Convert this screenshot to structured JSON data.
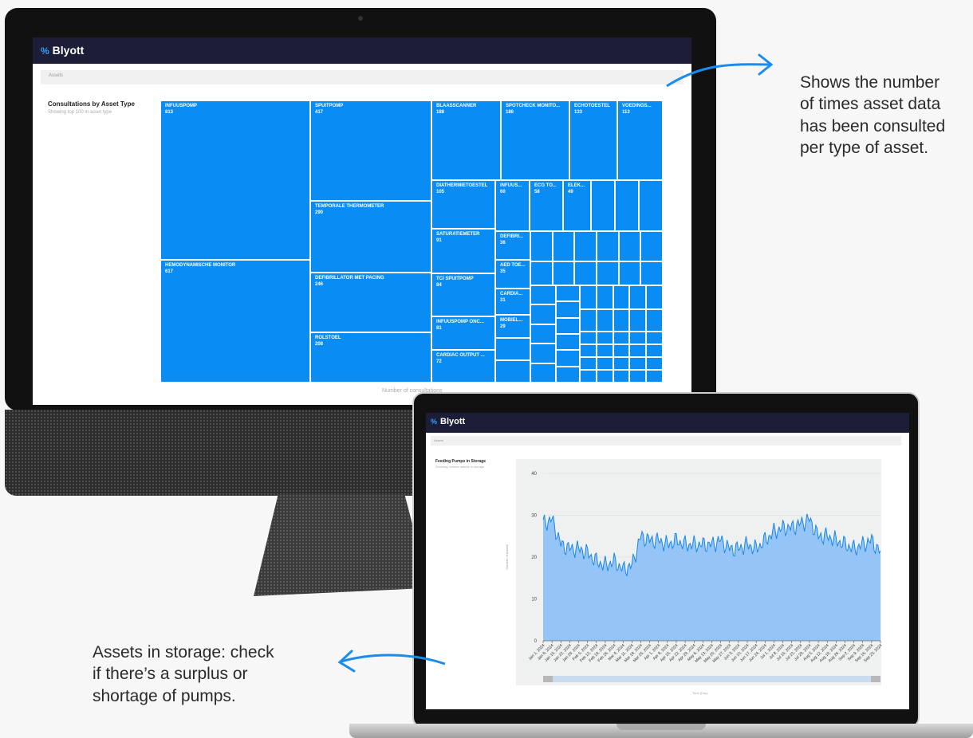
{
  "desktop": {
    "app": {
      "brand": "Blyott",
      "breadcrumb": "Assets"
    },
    "panel": {
      "title": "Consultations by Asset Type",
      "subtitle": "Showing top 100 in asset type",
      "xlabel": "Number of consultations"
    },
    "chart_data": {
      "type": "treemap",
      "title": "Consultations by Asset Type",
      "items": [
        {
          "label": "INFUUSPOMP",
          "value": 813
        },
        {
          "label": "HEMODYNAMISCHE MONITOR",
          "value": 617
        },
        {
          "label": "SPUITPOMP",
          "value": 417
        },
        {
          "label": "TEMPORALE THERMOMETER",
          "value": 290
        },
        {
          "label": "DEFIBRILLATOR MET PACING",
          "value": 246
        },
        {
          "label": "ROLSTOEL",
          "value": 208
        },
        {
          "label": "BLAASSCANNER",
          "value": 188
        },
        {
          "label": "SPOTCHECK MONITO...",
          "value": 186
        },
        {
          "label": "ECHOTOESTEL",
          "value": 133
        },
        {
          "label": "VOEDINGS...",
          "value": 113
        },
        {
          "label": "DIATHERMIETOESTEL",
          "value": 105
        },
        {
          "label": "SATURATIEMETER",
          "value": 91
        },
        {
          "label": "TCI SPUITPOMP",
          "value": 84
        },
        {
          "label": "INFUUSPOMP ONC...",
          "value": 81
        },
        {
          "label": "CARDIAC OUTPUT ...",
          "value": 72
        },
        {
          "label": "INFUUS...",
          "value": 60
        },
        {
          "label": "ECG TO...",
          "value": 58
        },
        {
          "label": "ELEK...",
          "value": 49
        },
        {
          "label": "DEFIBRI...",
          "value": 36
        },
        {
          "label": "AED TOE...",
          "value": 35
        },
        {
          "label": "CARDIA...",
          "value": 31
        },
        {
          "label": "MOBIEL...",
          "value": 29
        }
      ]
    }
  },
  "laptop": {
    "app": {
      "brand": "Blyott",
      "breadcrumb": "Assets"
    },
    "panel": {
      "title": "Feeding Pumps in Storage",
      "subtitle": "Showing number assets in storage"
    },
    "chart_data": {
      "type": "area",
      "xlabel": "Time (Day)",
      "ylabel": "Number of Assets",
      "ylim": [
        0,
        40
      ],
      "yticks": [
        0,
        10,
        20,
        30,
        40
      ],
      "x_tick_labels": [
        "Jan 1, 2024",
        "Jan 8, 2024",
        "Jan 15, 2024",
        "Jan 22, 2024",
        "Jan 29, 2024",
        "Feb 5, 2024",
        "Feb 12, 2024",
        "Feb 19, 2024",
        "Feb 26, 2024",
        "Mar 4, 2024",
        "Mar 11, 2024",
        "Mar 18, 2024",
        "Mar 25, 2024",
        "Apr 1, 2024",
        "Apr 8, 2024",
        "Apr 15, 2024",
        "Apr 22, 2024",
        "Apr 29, 2024",
        "May 6, 2024",
        "May 13, 2024",
        "May 20, 2024",
        "May 27, 2024",
        "Jun 3, 2024",
        "Jun 10, 2024",
        "Jun 17, 2024",
        "Jun 24, 2024",
        "Jul 1, 2024",
        "Jul 8, 2024",
        "Jul 15, 2024",
        "Jul 22, 2024",
        "Jul 29, 2024",
        "Aug 5, 2024",
        "Aug 12, 2024",
        "Aug 19, 2024",
        "Aug 26, 2024",
        "Sep 2, 2024",
        "Sep 9, 2024",
        "Sep 16, 2024",
        "Sep 23, 2024"
      ],
      "weekly_values": [
        28,
        29,
        23,
        22,
        22,
        21,
        19,
        18,
        19,
        17,
        18,
        25,
        24,
        24,
        23,
        24,
        23,
        23,
        23,
        23,
        24,
        22,
        22,
        23,
        22,
        24,
        26,
        27,
        27,
        28,
        29,
        25,
        25,
        24,
        23,
        22,
        23,
        24,
        21
      ]
    }
  },
  "callouts": {
    "top": [
      "Shows the number",
      "of times asset data",
      "has been consulted",
      "per type of asset."
    ],
    "bottom": [
      "Assets in storage: check",
      "if there’s a surplus or",
      "shortage of pumps."
    ]
  },
  "colors": {
    "nav": "#1c1d36",
    "tile": "#0a8cf5",
    "arrow": "#1a8cf0",
    "area": "#8fc2f5",
    "line": "#1a86e8"
  }
}
